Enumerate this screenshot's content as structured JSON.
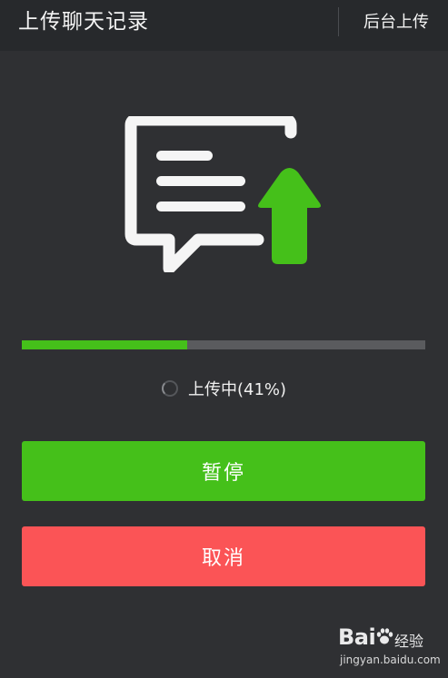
{
  "header": {
    "title": "上传聊天记录",
    "background_upload_label": "后台上传"
  },
  "hero": {
    "icon": "chat-upload-icon",
    "arrow_color": "#45c01a"
  },
  "progress": {
    "percent": 41,
    "status_text": "上传中(41%)",
    "fill_color": "#45c01a"
  },
  "actions": {
    "pause_label": "暂停",
    "cancel_label": "取消",
    "pause_color": "#45c01a",
    "cancel_color": "#fb5456"
  },
  "watermark": {
    "logo_text": "Bai",
    "logo_suffix": "经验",
    "url": "jingyan.baidu.com"
  }
}
